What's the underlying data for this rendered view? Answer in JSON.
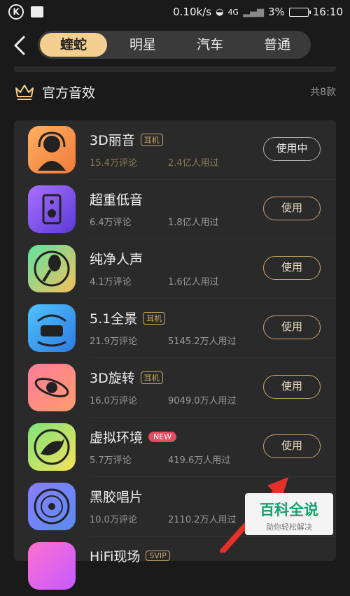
{
  "status_bar": {
    "speed": "0.10k/s",
    "network": "4G",
    "battery": "3%",
    "time": "16:10"
  },
  "tabs": [
    {
      "label": "蝰蛇",
      "active": true
    },
    {
      "label": "明星",
      "active": false
    },
    {
      "label": "汽车",
      "active": false
    },
    {
      "label": "普通",
      "active": false
    }
  ],
  "section": {
    "title": "官方音效",
    "count": "共8款"
  },
  "effects": [
    {
      "name": "3D丽音",
      "badge": "耳机",
      "reviews": "15.4万评论",
      "users": "2.4亿人用过",
      "button": "使用中"
    },
    {
      "name": "超重低音",
      "badge": "",
      "reviews": "6.4万评论",
      "users": "1.8亿人用过",
      "button": "使用"
    },
    {
      "name": "纯净人声",
      "badge": "",
      "reviews": "4.1万评论",
      "users": "1.6亿人用过",
      "button": "使用"
    },
    {
      "name": "5.1全景",
      "badge": "耳机",
      "reviews": "21.9万评论",
      "users": "5145.2万人用过",
      "button": "使用"
    },
    {
      "name": "3D旋转",
      "badge": "耳机",
      "reviews": "16.0万评论",
      "users": "9049.0万人用过",
      "button": "使用"
    },
    {
      "name": "虚拟环境",
      "badge": "NEW",
      "reviews": "5.7万评论",
      "users": "419.6万人用过",
      "button": "使用"
    },
    {
      "name": "黑胶唱片",
      "badge": "",
      "reviews": "10.0万评论",
      "users": "2110.2万人用过",
      "button": ""
    },
    {
      "name": "HiFi现场",
      "badge": "SVIP",
      "reviews": "",
      "users": "",
      "button": ""
    }
  ],
  "watermark": {
    "main": "百科全说",
    "sub": "助你轻松解决"
  },
  "colors": {
    "accent": "#f5cf8f",
    "background": "#1a1a1a",
    "new_badge": "#e64a5f"
  }
}
